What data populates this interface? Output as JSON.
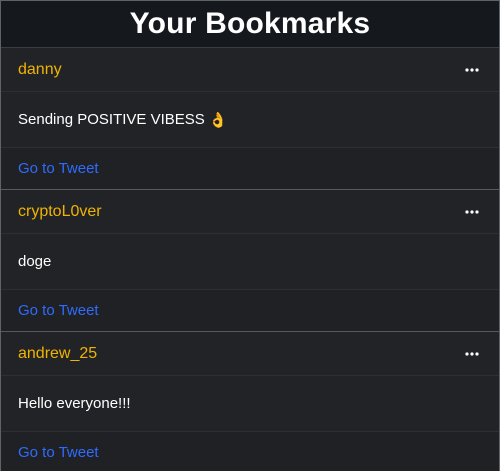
{
  "header": {
    "title": "Your Bookmarks"
  },
  "bookmarks": [
    {
      "user": "danny",
      "text": "Sending POSITIVE VIBESS",
      "emoji": "👌",
      "link_label": "Go to Tweet",
      "menu_icon": "more-horizontal-icon"
    },
    {
      "user": "cryptoL0ver",
      "text": "doge",
      "link_label": "Go to Tweet",
      "menu_icon": "more-horizontal-icon"
    },
    {
      "user": "andrew_25",
      "text": "Hello everyone!!!",
      "link_label": "Go to Tweet",
      "menu_icon": "more-horizontal-icon"
    }
  ],
  "colors": {
    "username": "#f0b400",
    "link": "#2f6bff",
    "background": "#202226",
    "header": "#15181d"
  }
}
